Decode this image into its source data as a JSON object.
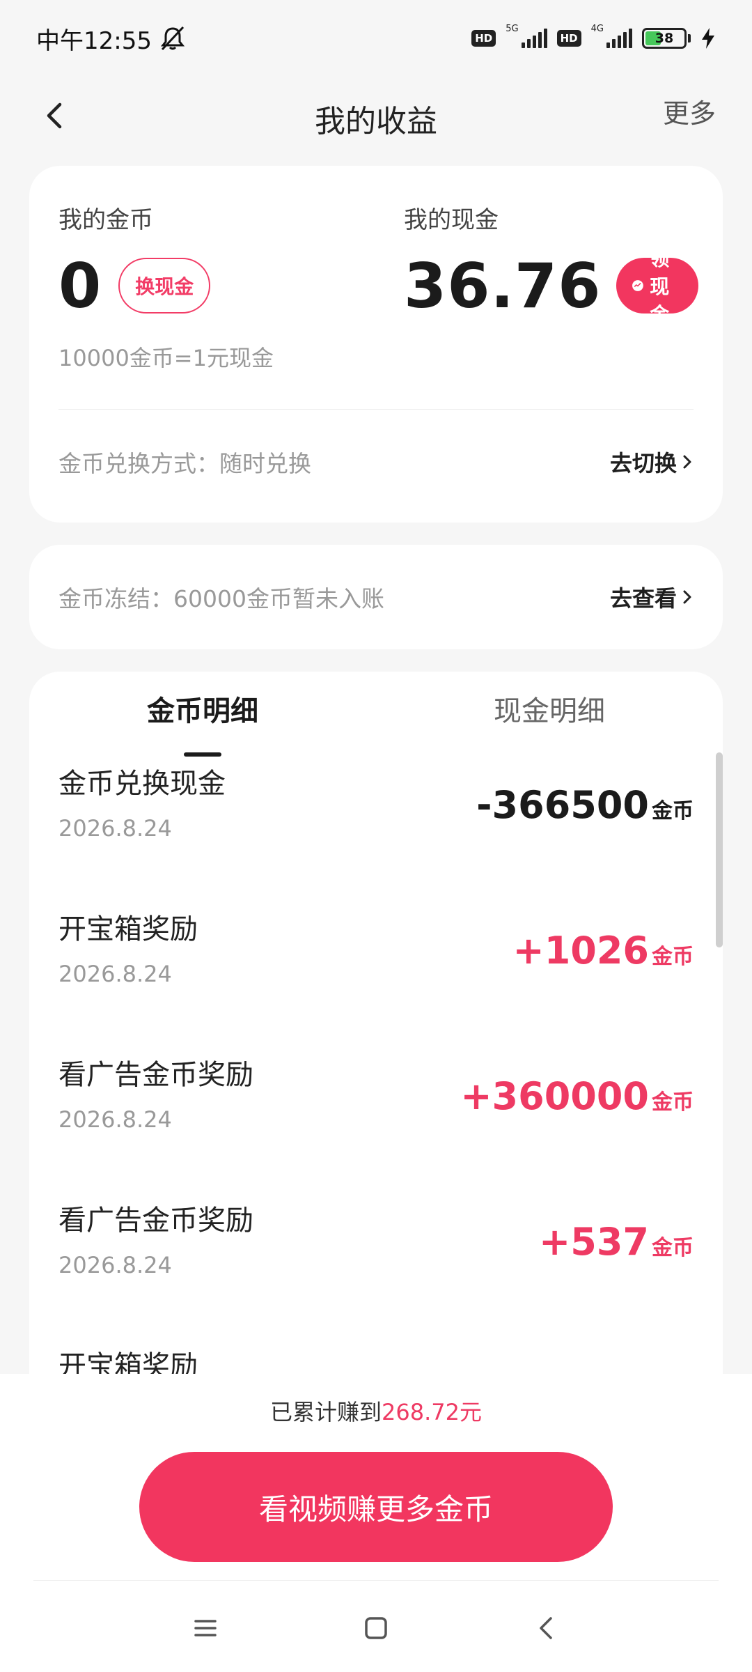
{
  "status_bar": {
    "time": "中午12:55",
    "hd1": "HD",
    "net1": "5G",
    "hd2": "HD",
    "net2": "4G",
    "battery": "38",
    "icons": [
      "mute-icon",
      "signal-icon",
      "battery-icon",
      "charging-icon"
    ]
  },
  "header": {
    "title": "我的收益",
    "more": "更多",
    "back_icon": "chevron-left-icon"
  },
  "balance_card": {
    "coins_label": "我的金币",
    "coins_value": "0",
    "exchange_button": "换现金",
    "cash_label": "我的现金",
    "cash_value": "36.76",
    "withdraw_button": "领现金",
    "rate_text": "10000金币=1元现金",
    "exchange_mode_text": "金币兑换方式：随时兑换",
    "switch_link": "去切换"
  },
  "frozen_card": {
    "text": "金币冻结：60000金币暂未入账",
    "view_link": "去查看"
  },
  "details": {
    "tabs": [
      {
        "label": "金币明细",
        "active": true
      },
      {
        "label": "现金明细",
        "active": false
      }
    ],
    "unit": "金币",
    "records": [
      {
        "title": "金币兑换现金",
        "date": "2026.8.24",
        "amount": "-366500"
      },
      {
        "title": "开宝箱奖励",
        "date": "2026.8.24",
        "amount": "+1026"
      },
      {
        "title": "看广告金币奖励",
        "date": "2026.8.24",
        "amount": "+360000"
      },
      {
        "title": "看广告金币奖励",
        "date": "2026.8.24",
        "amount": "+537"
      },
      {
        "title": "开宝箱奖励",
        "date": "",
        "amount": ""
      }
    ]
  },
  "bottom": {
    "total_prefix": "已累计赚到",
    "total_amount": "268.72元",
    "main_button": "看视频赚更多金币"
  },
  "colors": {
    "accent": "#f2365f",
    "positive": "#ee3a63",
    "background": "#f6f6f6"
  }
}
